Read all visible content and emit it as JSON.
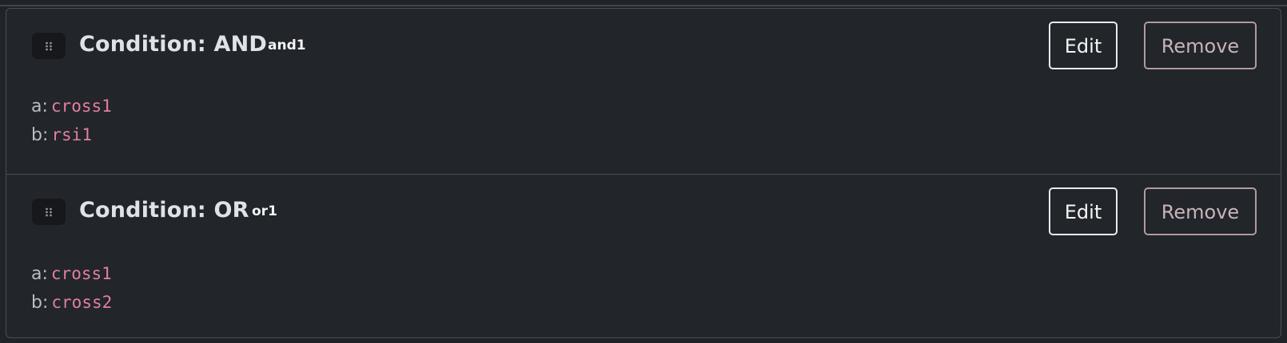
{
  "conditions": [
    {
      "title": "Condition: AND",
      "id": "and1",
      "edit_label": "Edit",
      "remove_label": "Remove",
      "fields": [
        {
          "key": "a:",
          "value": "cross1"
        },
        {
          "key": "b:",
          "value": "rsi1"
        }
      ]
    },
    {
      "title": "Condition: OR",
      "id": "or1",
      "edit_label": "Edit",
      "remove_label": "Remove",
      "fields": [
        {
          "key": "a:",
          "value": "cross1"
        },
        {
          "key": "b:",
          "value": "cross2"
        }
      ]
    }
  ],
  "icons": {
    "drag": "drag-handle-icon"
  },
  "colors": {
    "background": "#22252a",
    "value_text": "#e27fa3",
    "remove_border": "#b09aa0"
  }
}
